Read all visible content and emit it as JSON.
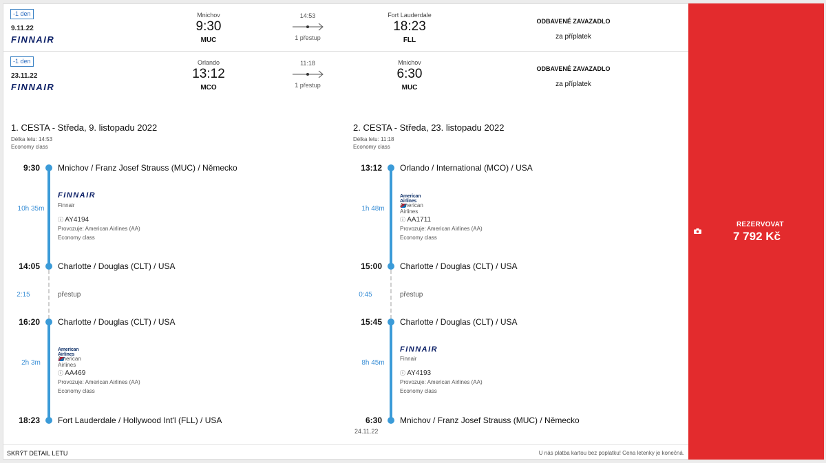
{
  "summary": [
    {
      "badge": "-1 den",
      "date": "9.11.22",
      "airline": "FINNAIR",
      "dep_city": "Mnichov",
      "dep_time": "9:30",
      "dep_code": "MUC",
      "duration": "14:53",
      "stops": "1 přestup",
      "arr_city": "Fort Lauderdale",
      "arr_time": "18:23",
      "arr_code": "FLL",
      "baggage_title": "ODBAVENÉ ZAVAZADLO",
      "baggage_note": "za příplatek"
    },
    {
      "badge": "-1 den",
      "date": "23.11.22",
      "airline": "FINNAIR",
      "dep_city": "Orlando",
      "dep_time": "13:12",
      "dep_code": "MCO",
      "duration": "11:18",
      "stops": "1 přestup",
      "arr_city": "Mnichov",
      "arr_time": "6:30",
      "arr_code": "MUC",
      "baggage_title": "ODBAVENÉ ZAVAZADLO",
      "baggage_note": "za příplatek"
    }
  ],
  "legs": [
    {
      "title": "1. CESTA - Středa, 9. listopadu 2022",
      "length": "Délka letu: 14:53",
      "class": "Economy class",
      "stops": [
        {
          "time": "9:30",
          "place": "Mnichov / Franz Josef Strauss (MUC) / Německo"
        },
        {
          "time": "14:05",
          "place": "Charlotte / Douglas (CLT) / USA"
        },
        {
          "time": "16:20",
          "place": "Charlotte / Douglas (CLT) / USA"
        },
        {
          "time": "18:23",
          "place": "Fort Lauderdale / Hollywood Int'l (FLL) / USA"
        }
      ],
      "segments": [
        {
          "duration": "10h 35m",
          "logo": "FINNAIR",
          "airline": "Finnair",
          "flight": "AY4194",
          "operated": "Provozuje: American Airlines (AA)",
          "class": "Economy class"
        },
        {
          "duration": "2h 3m",
          "logo": "American Airlines",
          "airline": "American Airlines",
          "flight": "AA469",
          "operated": "Provozuje: American Airlines (AA)",
          "class": "Economy class"
        }
      ],
      "transfer": {
        "duration": "2:15",
        "label": "přestup"
      },
      "arrival_date": ""
    },
    {
      "title": "2. CESTA - Středa, 23. listopadu 2022",
      "length": "Délka letu: 11:18",
      "class": "Economy class",
      "stops": [
        {
          "time": "13:12",
          "place": "Orlando / International (MCO) / USA"
        },
        {
          "time": "15:00",
          "place": "Charlotte / Douglas (CLT) / USA"
        },
        {
          "time": "15:45",
          "place": "Charlotte / Douglas (CLT) / USA"
        },
        {
          "time": "6:30",
          "place": "Mnichov / Franz Josef Strauss (MUC) / Německo"
        }
      ],
      "segments": [
        {
          "duration": "1h 48m",
          "logo": "American Airlines",
          "airline": "American Airlines",
          "flight": "AA1711",
          "operated": "Provozuje: American Airlines (AA)",
          "class": "Economy class"
        },
        {
          "duration": "8h 45m",
          "logo": "FINNAIR",
          "airline": "Finnair",
          "flight": "AY4193",
          "operated": "Provozuje: American Airlines (AA)",
          "class": "Economy class"
        }
      ],
      "transfer": {
        "duration": "0:45",
        "label": "přestup"
      },
      "arrival_date": "24.11.22"
    }
  ],
  "cta": {
    "label": "REZERVOVAT",
    "price": "7 792 Kč",
    "icon": "camera-icon"
  },
  "footer": {
    "toggle": "SKRÝT DETAIL LETU",
    "note": "U nás platba kartou bez poplatku! Cena letenky je konečná."
  },
  "colors": {
    "accent": "#e32b2d",
    "timeline": "#3b9bd8",
    "badge": "#3b82c4"
  }
}
